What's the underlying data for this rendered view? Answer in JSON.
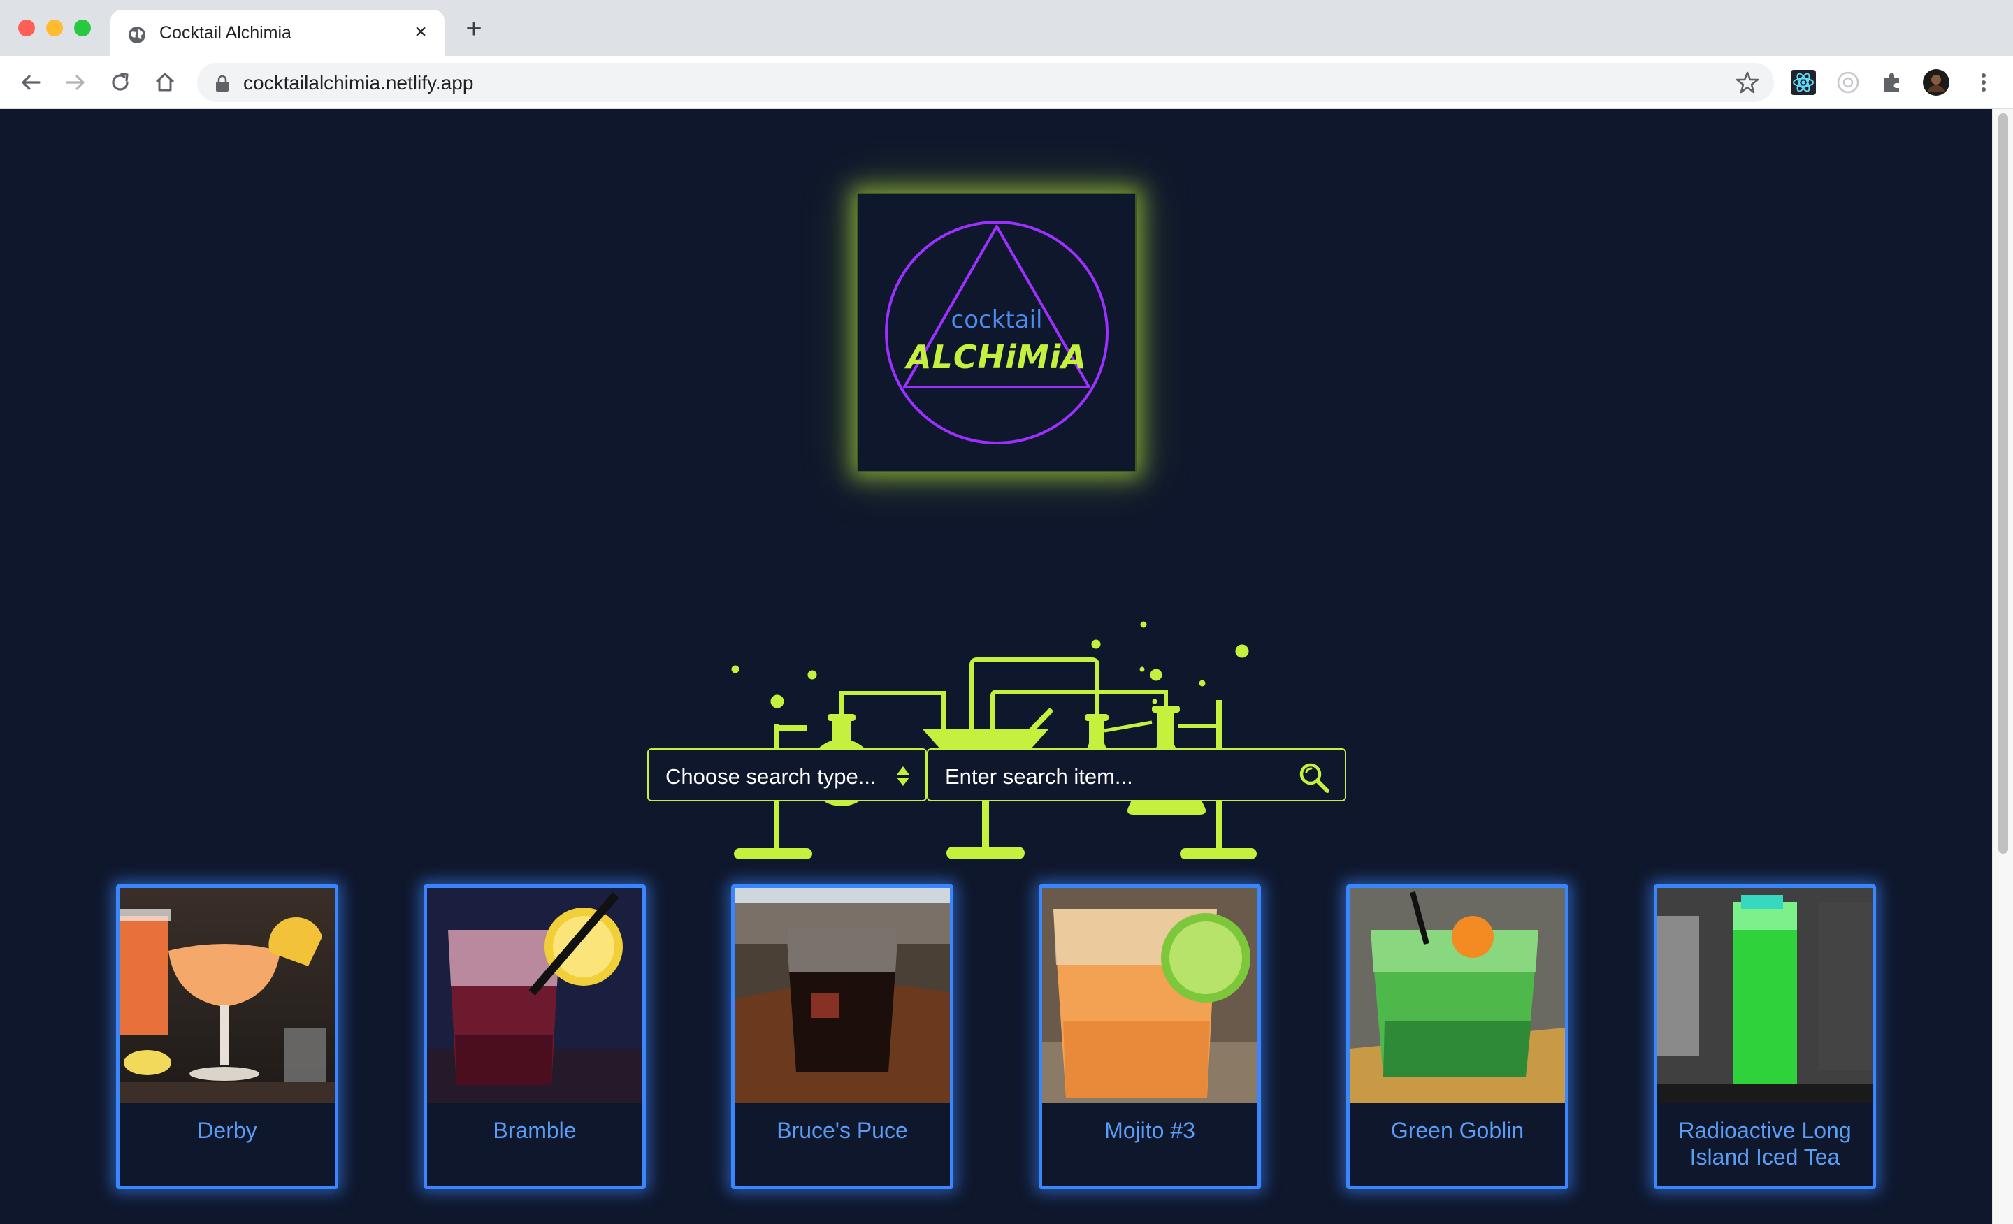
{
  "browser": {
    "tab_title": "Cocktail Alchimia",
    "tab_close": "×",
    "new_tab": "+",
    "url": "cocktailalchimia.netlify.app"
  },
  "logo": {
    "word_small": "cocktail",
    "word_big": "ALCHiMiA"
  },
  "search": {
    "type_placeholder": "Choose search type...",
    "item_placeholder": "Enter search item..."
  },
  "colors": {
    "background": "#0f172c",
    "accent_green": "#c6f03e",
    "accent_blue": "#3a86ff",
    "logo_purple": "#9b30ff"
  },
  "cocktails": [
    {
      "name": "Derby"
    },
    {
      "name": "Bramble"
    },
    {
      "name": "Bruce's Puce"
    },
    {
      "name": "Mojito #3"
    },
    {
      "name": "Green Goblin"
    },
    {
      "name": "Radioactive Long Island Iced Tea"
    }
  ]
}
